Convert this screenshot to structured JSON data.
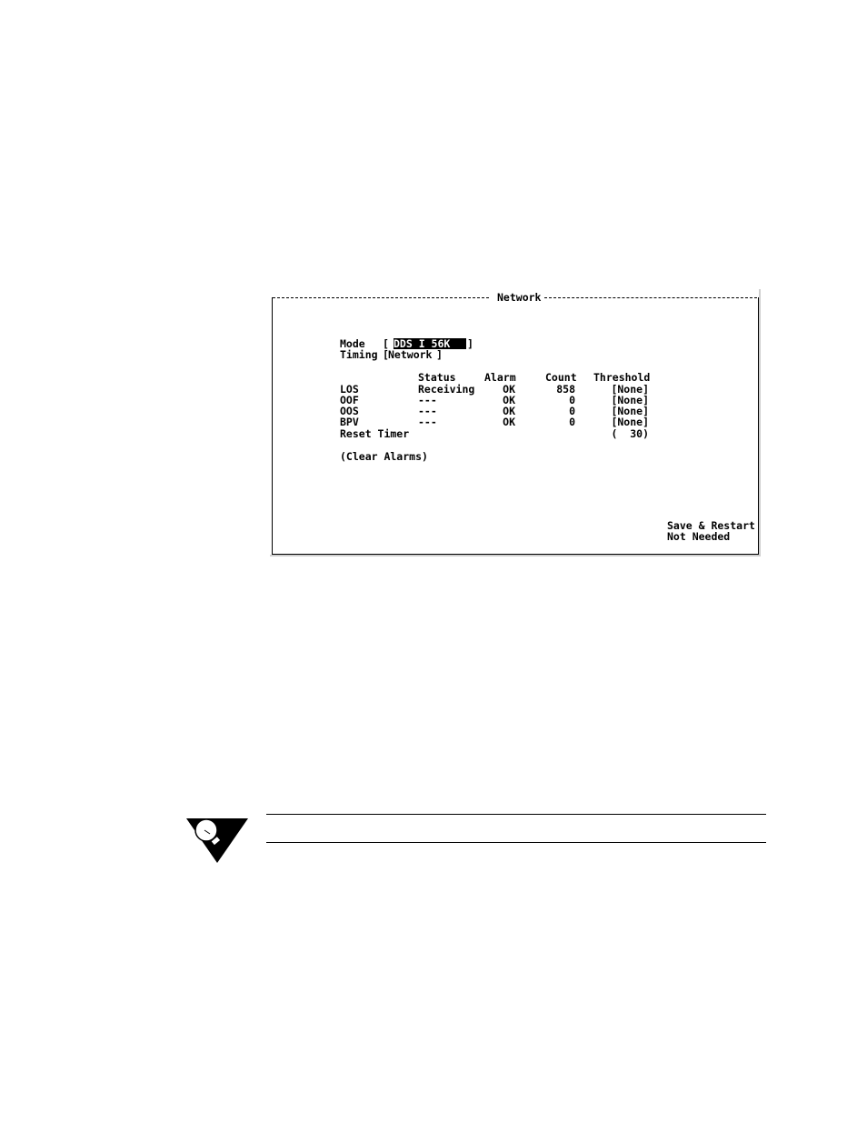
{
  "window": {
    "title": "Network"
  },
  "form": {
    "mode_label": "Mode",
    "mode_value": "DDS I 56K",
    "timing_label": "Timing",
    "timing_value": "Network"
  },
  "table": {
    "headers": {
      "status": "Status",
      "alarm": "Alarm",
      "count": "Count",
      "threshold": "Threshold"
    },
    "rows": [
      {
        "name": "LOS",
        "status": "Receiving",
        "alarm": "OK",
        "count": "858",
        "threshold": "[None]"
      },
      {
        "name": "OOF",
        "status": "---",
        "alarm": "OK",
        "count": "0",
        "threshold": "[None]"
      },
      {
        "name": "OOS",
        "status": "---",
        "alarm": "OK",
        "count": "0",
        "threshold": "[None]"
      },
      {
        "name": "BPV",
        "status": "---",
        "alarm": "OK",
        "count": "0",
        "threshold": "[None]"
      }
    ],
    "reset_timer_label": "Reset Timer",
    "reset_timer_value": "(  30)"
  },
  "actions": {
    "clear_alarms": "(Clear Alarms)",
    "save_restart": "Save & Restart",
    "save_status": "Not Needed"
  },
  "note": {
    "icon": "lightbulb-icon"
  }
}
